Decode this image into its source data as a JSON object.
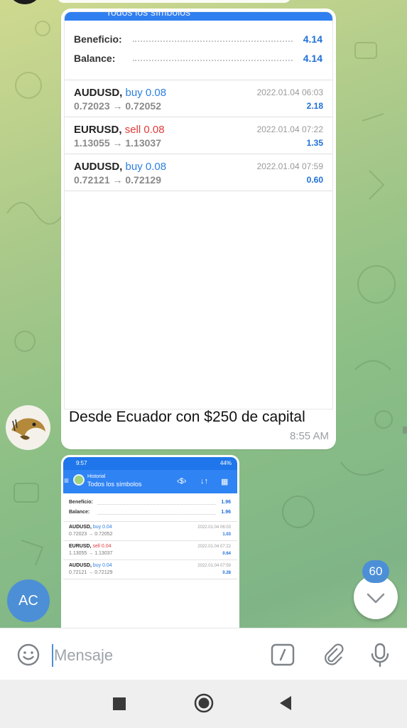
{
  "message1": {
    "image": {
      "header_partial": "Todos los símbolos",
      "summary": [
        {
          "label": "Beneficio:",
          "value": "4.14"
        },
        {
          "label": "Balance:",
          "value": "4.14"
        }
      ],
      "trades": [
        {
          "symbol": "AUDUSD,",
          "direction": "buy 0.08",
          "type": "buy",
          "prices": "0.72023 → 0.72052",
          "date": "2022.01.04 06:03",
          "profit": "2.18"
        },
        {
          "symbol": "EURUSD,",
          "direction": "sell 0.08",
          "type": "sell",
          "prices": "1.13055 → 1.13037",
          "date": "2022.01.04 07:22",
          "profit": "1.35"
        },
        {
          "symbol": "AUDUSD,",
          "direction": "buy 0.08",
          "type": "buy",
          "prices": "0.72121 → 0.72129",
          "date": "2022.01.04 07:59",
          "profit": "0.60"
        }
      ]
    },
    "caption": "Desde Ecuador con $250 de capital",
    "time": "8:55 AM"
  },
  "message2": {
    "image": {
      "status_time": "9:57",
      "status_battery": "44%",
      "app_subtitle": "Historial",
      "app_title": "Todos los símbolos",
      "summary": [
        {
          "label": "Beneficio:",
          "value": "1.96"
        },
        {
          "label": "Balance:",
          "value": "1.96"
        }
      ],
      "trades": [
        {
          "symbol": "AUDUSD,",
          "direction": "buy 0.04",
          "type": "buy",
          "prices": "0.72023 → 0.72052",
          "date": "2022.01.04 06:03",
          "profit": "1.03"
        },
        {
          "symbol": "EURUSD,",
          "direction": "sell 0.04",
          "type": "sell",
          "prices": "1.13055 → 1.13037",
          "date": "2022.01.04 07:22",
          "profit": "0.64"
        },
        {
          "symbol": "AUDUSD,",
          "direction": "buy 0.04",
          "type": "buy",
          "prices": "0.72121 → 0.72129",
          "date": "2022.01.04 07:59",
          "profit": "0.28"
        }
      ]
    }
  },
  "user_avatar_initials": "AC",
  "unread_badge": "60",
  "composer": {
    "placeholder": "Mensaje"
  },
  "colors": {
    "accent": "#4c8fd6",
    "buy": "#2b7fe0",
    "sell": "#e03a3a",
    "mt_header": "#2f83f3"
  },
  "icons": [
    "emoji-icon",
    "bot-command-icon",
    "attach-icon",
    "microphone-icon",
    "chevron-down-icon",
    "nav-recents-icon",
    "nav-home-icon",
    "nav-back-icon"
  ]
}
